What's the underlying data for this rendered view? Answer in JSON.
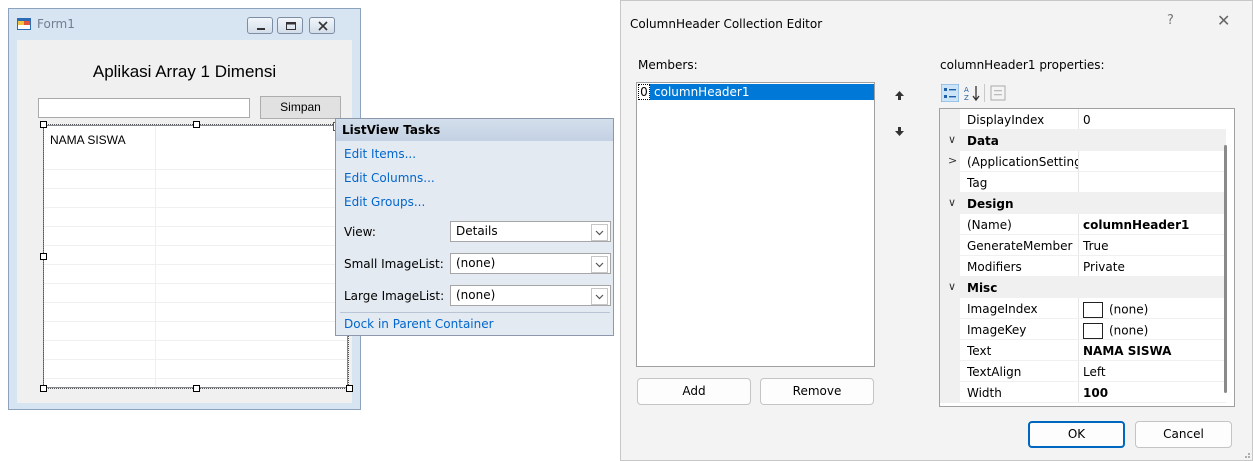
{
  "form1": {
    "title": "Form1",
    "heading": "Aplikasi Array 1 Dimensi",
    "textbox_value": "",
    "simpan_label": "Simpan",
    "column_header": "NAMA SISWA"
  },
  "tasks": {
    "header": "ListView Tasks",
    "edit_items": "Edit Items...",
    "edit_columns": "Edit Columns...",
    "edit_groups": "Edit Groups...",
    "view_label": "View:",
    "view_value": "Details",
    "small_label": "Small ImageList:",
    "small_value": "(none)",
    "large_label": "Large ImageList:",
    "large_value": "(none)",
    "dock": "Dock in Parent Container"
  },
  "editor": {
    "title": "ColumnHeader Collection Editor",
    "help": "?",
    "close": "✕",
    "members_label": "Members:",
    "member_index": "0",
    "member_name": "columnHeader1",
    "properties_label": "columnHeader1 properties:",
    "add": "Add",
    "remove": "Remove",
    "ok": "OK",
    "cancel": "Cancel",
    "accent": "#0078d7",
    "properties": [
      {
        "kind": "prop",
        "name": "DisplayIndex",
        "value": "0"
      },
      {
        "kind": "cat",
        "name": "Data",
        "chev": "∨"
      },
      {
        "kind": "prop",
        "name": "(ApplicationSettings)",
        "value": "",
        "chev": ">"
      },
      {
        "kind": "prop",
        "name": "Tag",
        "value": ""
      },
      {
        "kind": "cat",
        "name": "Design",
        "chev": "∨"
      },
      {
        "kind": "prop",
        "name": "(Name)",
        "value": "columnHeader1",
        "bold": true
      },
      {
        "kind": "prop",
        "name": "GenerateMember",
        "value": "True"
      },
      {
        "kind": "prop",
        "name": "Modifiers",
        "value": "Private"
      },
      {
        "kind": "cat",
        "name": "Misc",
        "chev": "∨"
      },
      {
        "kind": "prop",
        "name": "ImageIndex",
        "value": "(none)",
        "swatch": true
      },
      {
        "kind": "prop",
        "name": "ImageKey",
        "value": "(none)",
        "swatch": true
      },
      {
        "kind": "prop",
        "name": "Text",
        "value": "NAMA SISWA",
        "bold": true
      },
      {
        "kind": "prop",
        "name": "TextAlign",
        "value": "Left"
      },
      {
        "kind": "prop",
        "name": "Width",
        "value": "100",
        "bold": true
      }
    ]
  }
}
